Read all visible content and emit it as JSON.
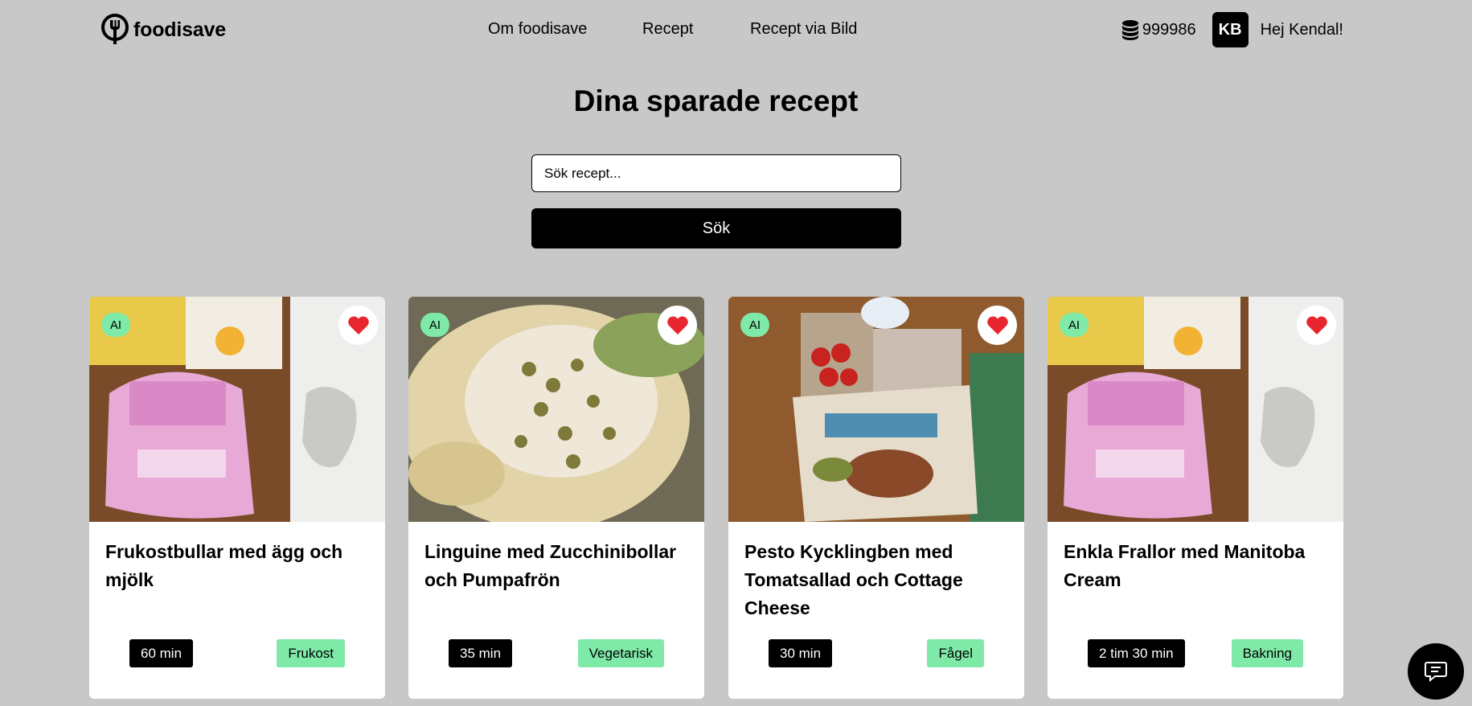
{
  "brand": {
    "name": "foodisave"
  },
  "nav": [
    {
      "label": "Om foodisave"
    },
    {
      "label": "Recept"
    },
    {
      "label": "Recept via Bild"
    }
  ],
  "user": {
    "coins": "999986",
    "initials": "KB",
    "greeting": "Hej Kendal!"
  },
  "page": {
    "title": "Dina sparade recept"
  },
  "search": {
    "placeholder": "Sök recept...",
    "button_label": "Sök"
  },
  "recipes": [
    {
      "title": "Frukostbullar med ägg och mjölk",
      "ai_badge": "AI",
      "time": "60 min",
      "category": "Frukost"
    },
    {
      "title": "Linguine med Zucchinibollar och Pumpafrön",
      "ai_badge": "AI",
      "time": "35 min",
      "category": "Vegetarisk"
    },
    {
      "title": "Pesto Kycklingben med Tomatsallad och Cottage Cheese",
      "ai_badge": "AI",
      "time": "30 min",
      "category": "Fågel"
    },
    {
      "title": "Enkla Frallor med Manitoba Cream",
      "ai_badge": "AI",
      "time": "2 tim 30 min",
      "category": "Bakning"
    }
  ],
  "colors": {
    "background": "#c8c8c8",
    "accent_green": "#7fe9a8",
    "heart_red": "#e8262f",
    "dark": "#000000"
  },
  "icons": {
    "logo": "spoon-fork-logo-icon",
    "coins": "coin-stack-icon",
    "favorite": "heart-icon",
    "chat": "chat-bubble-icon"
  }
}
